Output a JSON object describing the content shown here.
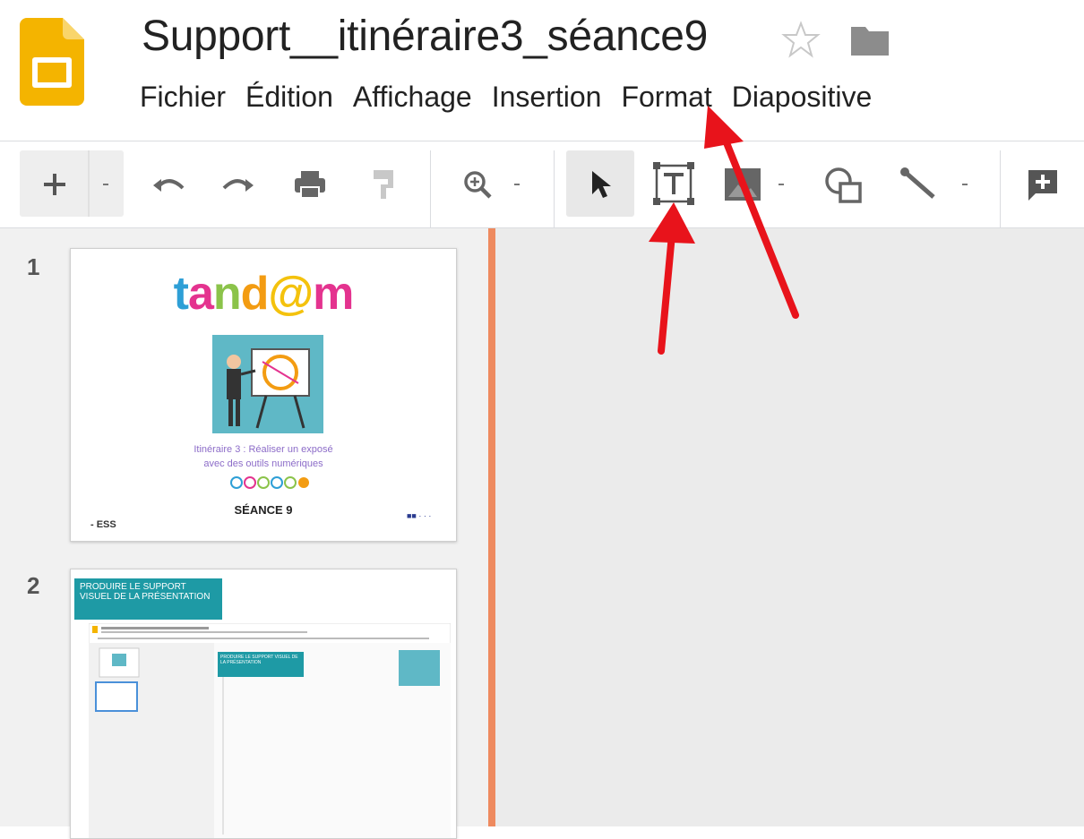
{
  "document": {
    "title": "Support__itinéraire3_séance9"
  },
  "menu": {
    "items": [
      "Fichier",
      "Édition",
      "Affichage",
      "Insertion",
      "Format",
      "Diapositive"
    ]
  },
  "toolbar": {
    "buttons": [
      {
        "name": "new-slide-button",
        "icon": "plus-icon"
      },
      {
        "name": "new-slide-dropdown",
        "icon": "caret-down-icon"
      },
      {
        "name": "undo-button",
        "icon": "undo-icon"
      },
      {
        "name": "redo-button",
        "icon": "redo-icon"
      },
      {
        "name": "print-button",
        "icon": "print-icon"
      },
      {
        "name": "paint-format-button",
        "icon": "paint-roller-icon"
      },
      {
        "name": "zoom-button",
        "icon": "zoom-in-icon"
      },
      {
        "name": "select-tool-button",
        "icon": "cursor-arrow-icon",
        "active": true
      },
      {
        "name": "text-box-button",
        "icon": "text-box-icon"
      },
      {
        "name": "image-button",
        "icon": "image-icon"
      },
      {
        "name": "shape-button",
        "icon": "shape-icon"
      },
      {
        "name": "line-button",
        "icon": "line-icon"
      },
      {
        "name": "comment-button",
        "icon": "add-comment-icon"
      }
    ]
  },
  "slides": [
    {
      "number": "1",
      "brand": "tandem",
      "subtitle_line1": "Itinéraire 3 : Réaliser un exposé",
      "subtitle_line2": "avec des outils numériques",
      "session": "SÉANCE 9",
      "logo_left": "- ESS",
      "logo_right": "■■ · · ·"
    },
    {
      "number": "2",
      "band_text": "PRODUIRE LE SUPPORT VISUEL DE LA PRÉSENTATION",
      "inner_band_text": "PRODUIRE LE SUPPORT VISUEL DE LA PRÉSENTATION"
    }
  ],
  "colors": {
    "accent_splitter": "#ee8a5f",
    "slides_logo": "#f4b400",
    "annotation_arrow": "#e8131b",
    "teal_band": "#1e9aa5"
  }
}
